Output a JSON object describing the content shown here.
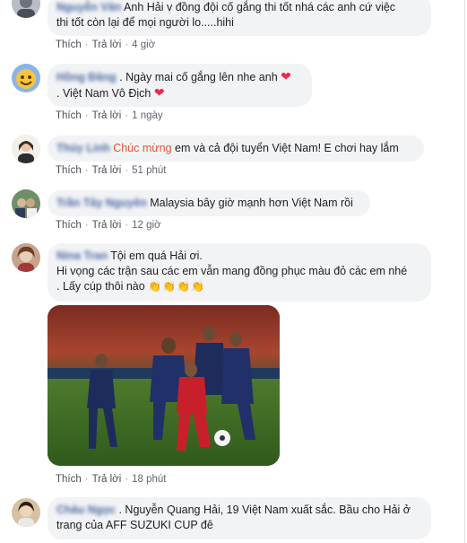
{
  "actions": {
    "like": "Thích",
    "reply": "Trả lời",
    "sep": "·"
  },
  "comments": [
    {
      "name_prefix": "Nguyễn",
      "name": "Nguyễn Văn",
      "line1": "Anh Hải v đồng đội cố gắng thi tốt nhá các anh cứ việc",
      "line2": "thi tốt còn lại để mọi người lo.....hihi",
      "time": "4 giờ"
    },
    {
      "name": "Hồng Đăng",
      "line1": ". Ngày mai cố gắng lên nhe anh",
      "line1_emoji": "❤",
      "line2": ". Việt Nam Vô Địch",
      "line2_emoji": "❤",
      "time": "1 ngày"
    },
    {
      "name": "Thúy Linh",
      "highlight": "Chúc mừng",
      "text": "em và cả đội tuyển Việt Nam! E chơi hay lắm",
      "time": "51 phút"
    },
    {
      "name": "Trần Tây Nguyên",
      "text": "Malaysia bây giờ mạnh hơn Việt Nam rồi",
      "time": "12 giờ"
    },
    {
      "name": "Nina Tran",
      "line1": "Tội em quá Hải ơi.",
      "line2": "Hi vọng các trận sau các em vẫn mang đồng phục màu đỏ các em nhé",
      "line3": ". Lấy cúp thôi nào",
      "claps": "👏👏👏👏",
      "time": "18 phút"
    },
    {
      "name": "Châu Ngọc",
      "line1": ". Nguyễn Quang Hải, 19 Việt Nam xuất sắc. Bầu cho Hải ở",
      "line2": "trang của AFF SUZUKI CUP đê"
    }
  ]
}
